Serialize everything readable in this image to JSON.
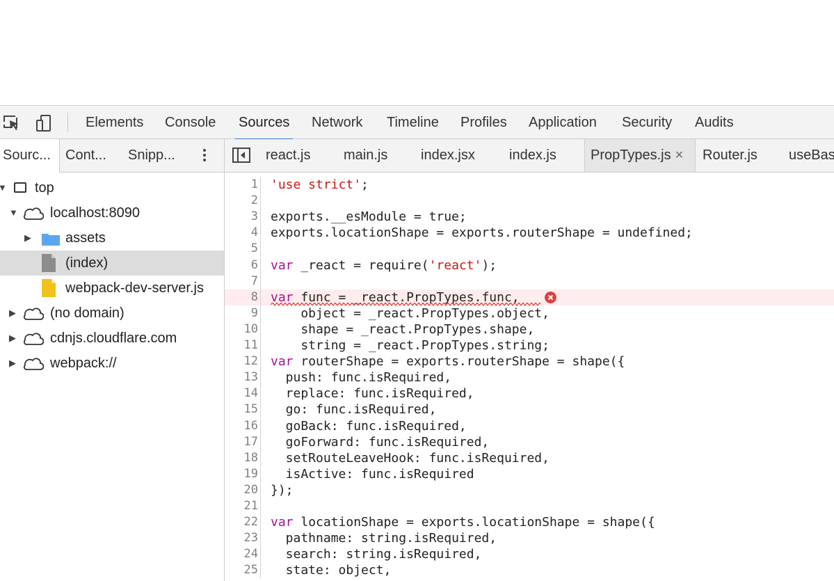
{
  "toolbar": {
    "tabs": [
      "Elements",
      "Console",
      "Sources",
      "Network",
      "Timeline",
      "Profiles",
      "Application",
      "Security",
      "Audits"
    ],
    "active_tab": "Sources"
  },
  "navigator": {
    "tabs": [
      "Sourc...",
      "Cont...",
      "Snipp..."
    ],
    "active_tab": "Sourc...",
    "tree": [
      {
        "label": "top",
        "kind": "frame",
        "expanded": true
      },
      {
        "label": "localhost:8090",
        "kind": "domain",
        "expanded": true
      },
      {
        "label": "assets",
        "kind": "folder",
        "expanded": false
      },
      {
        "label": "(index)",
        "kind": "file",
        "selected": true
      },
      {
        "label": "webpack-dev-server.js",
        "kind": "js-file"
      },
      {
        "label": "(no domain)",
        "kind": "domain",
        "expanded": false
      },
      {
        "label": "cdnjs.cloudflare.com",
        "kind": "domain",
        "expanded": false
      },
      {
        "label": "webpack://",
        "kind": "domain",
        "expanded": false
      }
    ]
  },
  "editor": {
    "open_files": [
      {
        "name": "react.js"
      },
      {
        "name": "main.js"
      },
      {
        "name": "index.jsx"
      },
      {
        "name": "index.js"
      },
      {
        "name": "PropTypes.js",
        "active": true,
        "close": "×"
      },
      {
        "name": "Router.js"
      },
      {
        "name": "useBas"
      }
    ],
    "error_line": 8,
    "lines": [
      {
        "n": "1",
        "code": "'use strict';"
      },
      {
        "n": "2",
        "code": ""
      },
      {
        "n": "3",
        "code": "exports.__esModule = true;"
      },
      {
        "n": "4",
        "code": "exports.locationShape = exports.routerShape = undefined;"
      },
      {
        "n": "5",
        "code": ""
      },
      {
        "n": "6",
        "code": "var _react = require('react');"
      },
      {
        "n": "7",
        "code": ""
      },
      {
        "n": "8",
        "code": "var func = _react.PropTypes.func,"
      },
      {
        "n": "9",
        "code": "    object = _react.PropTypes.object,"
      },
      {
        "n": "10",
        "code": "    shape = _react.PropTypes.shape,"
      },
      {
        "n": "11",
        "code": "    string = _react.PropTypes.string;"
      },
      {
        "n": "12",
        "code": "var routerShape = exports.routerShape = shape({"
      },
      {
        "n": "13",
        "code": "  push: func.isRequired,"
      },
      {
        "n": "14",
        "code": "  replace: func.isRequired,"
      },
      {
        "n": "15",
        "code": "  go: func.isRequired,"
      },
      {
        "n": "16",
        "code": "  goBack: func.isRequired,"
      },
      {
        "n": "17",
        "code": "  goForward: func.isRequired,"
      },
      {
        "n": "18",
        "code": "  setRouteLeaveHook: func.isRequired,"
      },
      {
        "n": "19",
        "code": "  isActive: func.isRequired"
      },
      {
        "n": "20",
        "code": "});"
      },
      {
        "n": "21",
        "code": ""
      },
      {
        "n": "22",
        "code": "var locationShape = exports.locationShape = shape({"
      },
      {
        "n": "23",
        "code": "  pathname: string.isRequired,"
      },
      {
        "n": "24",
        "code": "  search: string.isRequired,"
      },
      {
        "n": "25",
        "code": "  state: object,"
      }
    ]
  },
  "colors": {
    "keyword": "#aa0d91",
    "string": "#c41a16",
    "accent": "#3879d9",
    "error": "#e23e3e"
  }
}
